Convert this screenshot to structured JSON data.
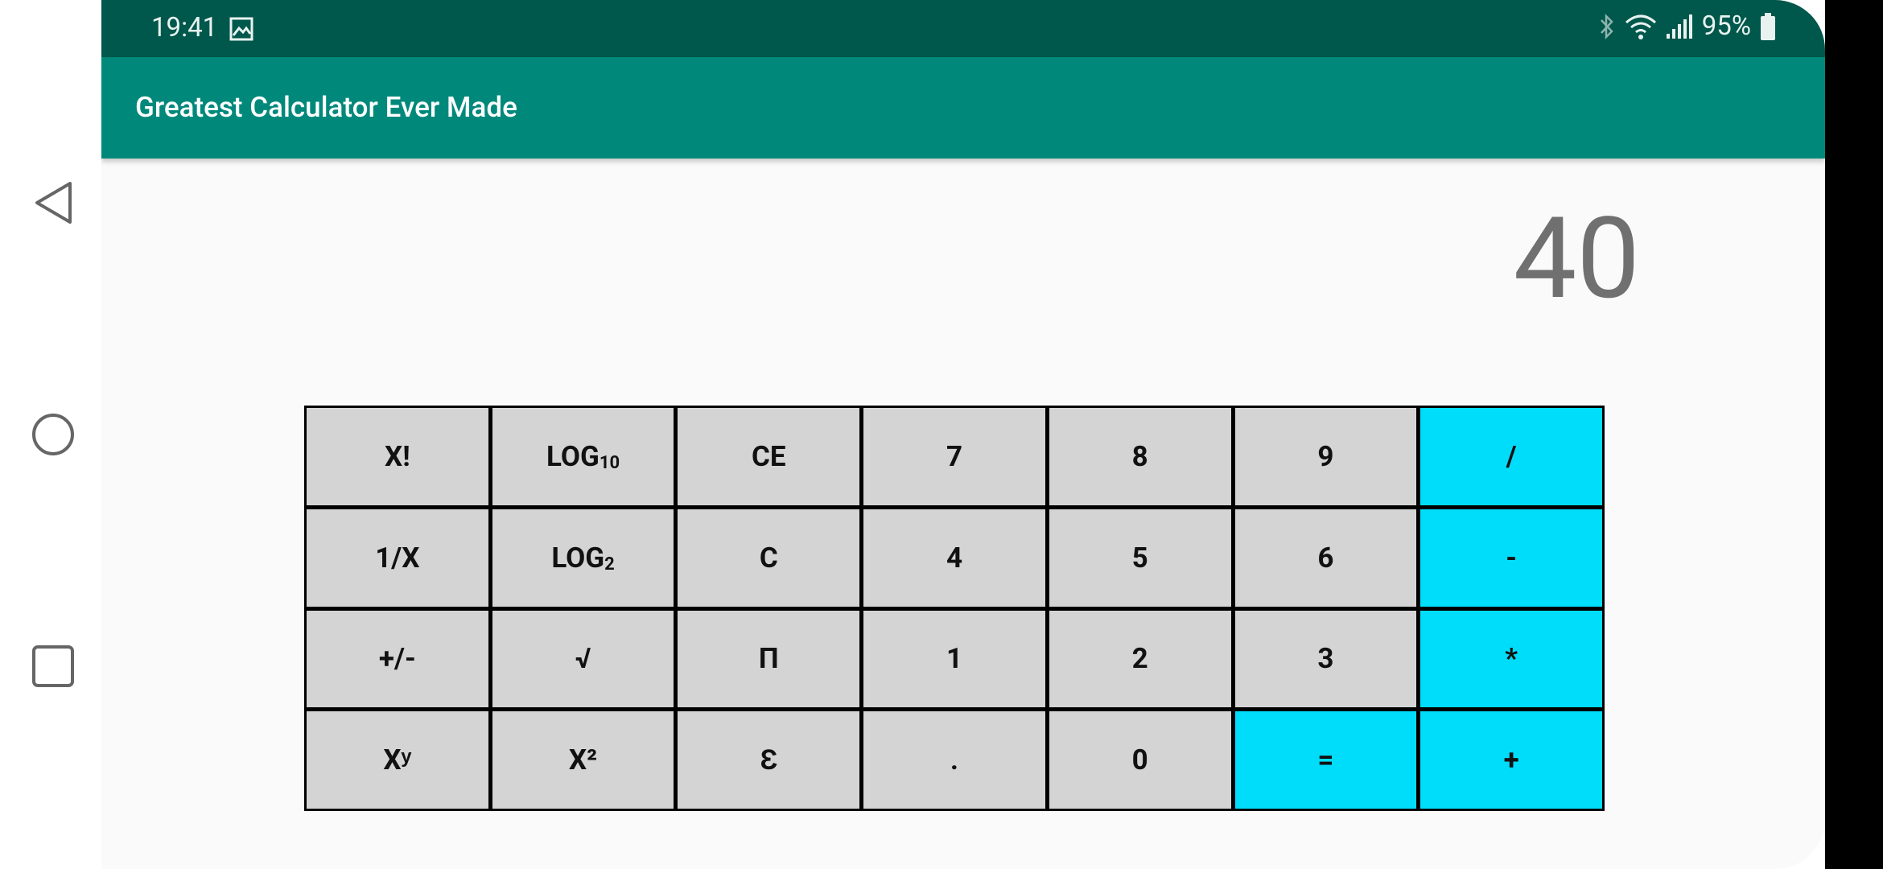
{
  "status_bar": {
    "time": "19:41",
    "battery": "95%",
    "icons": [
      "image-icon",
      "bluetooth-icon",
      "wifi-icon",
      "signal-icon",
      "battery-icon"
    ]
  },
  "app_bar": {
    "title": "Greatest Calculator Ever Made"
  },
  "display": {
    "value": "40"
  },
  "colors": {
    "status_bar": "#00574b",
    "app_bar": "#00897b",
    "key": "#d4d4d4",
    "accent_key": "#00ddfa",
    "display_text": "#707070"
  },
  "keypad": {
    "rows": [
      [
        {
          "label": "X!",
          "name": "factorial-key"
        },
        {
          "label": "LOG",
          "sub": "10",
          "name": "log10-key"
        },
        {
          "label": "CE",
          "name": "clear-entry-key"
        },
        {
          "label": "7",
          "name": "digit-7-key"
        },
        {
          "label": "8",
          "name": "digit-8-key"
        },
        {
          "label": "9",
          "name": "digit-9-key"
        },
        {
          "label": "/",
          "name": "divide-key",
          "accent": true
        }
      ],
      [
        {
          "label": "1/X",
          "name": "reciprocal-key"
        },
        {
          "label": "LOG",
          "sub": "2",
          "name": "log2-key"
        },
        {
          "label": "C",
          "name": "clear-key"
        },
        {
          "label": "4",
          "name": "digit-4-key"
        },
        {
          "label": "5",
          "name": "digit-5-key"
        },
        {
          "label": "6",
          "name": "digit-6-key"
        },
        {
          "label": "-",
          "name": "subtract-key",
          "accent": true
        }
      ],
      [
        {
          "label": "+/-",
          "name": "negate-key"
        },
        {
          "label": "√",
          "name": "sqrt-key"
        },
        {
          "label": "Π",
          "name": "pi-key"
        },
        {
          "label": "1",
          "name": "digit-1-key"
        },
        {
          "label": "2",
          "name": "digit-2-key"
        },
        {
          "label": "3",
          "name": "digit-3-key"
        },
        {
          "label": "*",
          "name": "multiply-key",
          "accent": true
        }
      ],
      [
        {
          "label": "Xʸ",
          "name": "power-key"
        },
        {
          "label": "X²",
          "name": "square-key"
        },
        {
          "label": "Ɛ",
          "name": "euler-key"
        },
        {
          "label": ".",
          "name": "decimal-key"
        },
        {
          "label": "0",
          "name": "digit-0-key"
        },
        {
          "label": "=",
          "name": "equals-key",
          "accent": true
        },
        {
          "label": "+",
          "name": "add-key",
          "accent": true
        }
      ]
    ]
  },
  "nav_bar": {
    "buttons": [
      "back-icon",
      "home-icon",
      "recents-icon"
    ]
  }
}
